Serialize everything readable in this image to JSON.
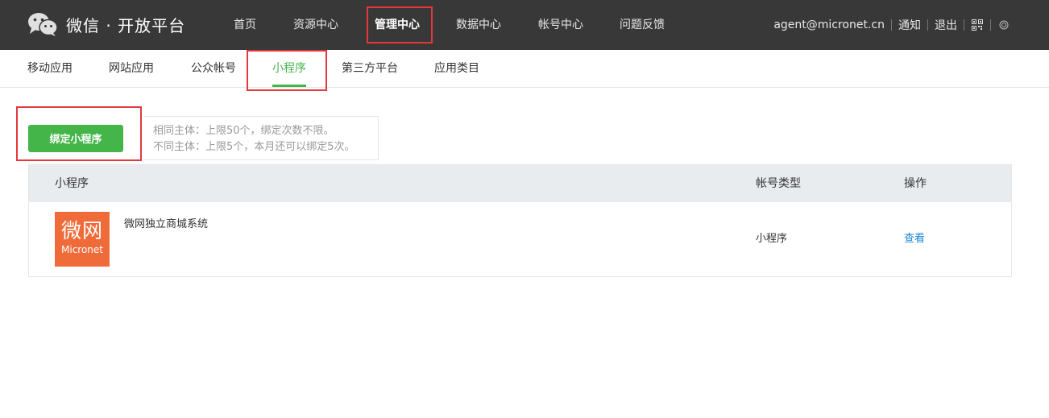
{
  "header": {
    "logo_text": "微信 · 开放平台",
    "nav": [
      "首页",
      "资源中心",
      "管理中心",
      "数据中心",
      "帐号中心",
      "问题反馈"
    ],
    "active_nav": "管理中心",
    "user_email": "agent@micronet.cn",
    "notify_label": "通知",
    "logout_label": "退出",
    "qrcode_icon": "qrcode-icon",
    "language_icon": "globe-icon"
  },
  "subnav": {
    "items": [
      "移动应用",
      "网站应用",
      "公众帐号",
      "小程序",
      "第三方平台",
      "应用类目"
    ],
    "active": "小程序"
  },
  "bind": {
    "button_label": "绑定小程序",
    "tip_line1": "相同主体：上限50个，绑定次数不限。",
    "tip_line2": "不同主体：上限5个，本月还可以绑定5次。"
  },
  "table": {
    "headers": [
      "小程序",
      "帐号类型",
      "操作"
    ],
    "rows": [
      {
        "logo_text_cn": "微网",
        "logo_text_en": "Micronet",
        "name": "微网独立商城系统",
        "type": "小程序",
        "action": "查看"
      }
    ]
  },
  "colors": {
    "topbar": "#383838",
    "accent_green": "#44b549",
    "highlight_red": "#e4393c",
    "link_blue": "#1a85d0",
    "logo_orange": "#f06b3a"
  }
}
